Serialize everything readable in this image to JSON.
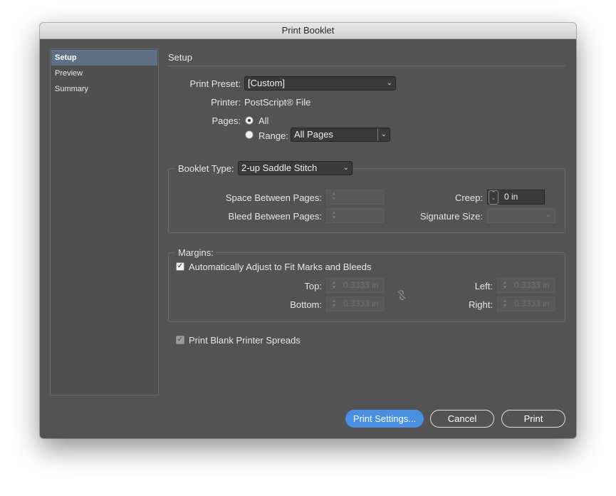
{
  "window": {
    "title": "Print Booklet"
  },
  "sidebar": {
    "items": [
      {
        "label": "Setup",
        "selected": true
      },
      {
        "label": "Preview",
        "selected": false
      },
      {
        "label": "Summary",
        "selected": false
      }
    ]
  },
  "setup": {
    "heading": "Setup",
    "preset_label": "Print Preset:",
    "preset_value": "[Custom]",
    "printer_label": "Printer:",
    "printer_value": "PostScript® File",
    "pages_label": "Pages:",
    "pages_all_label": "All",
    "pages_range_label": "Range:",
    "pages_range_value": "All Pages",
    "pages_selected": "All"
  },
  "booklet": {
    "type_label": "Booklet Type:",
    "type_value": "2-up Saddle Stitch",
    "space_label": "Space Between Pages:",
    "space_value": "",
    "bleed_label": "Bleed Between Pages:",
    "bleed_value": "",
    "creep_label": "Creep:",
    "creep_value": "0 in",
    "signature_label": "Signature Size:",
    "signature_value": ""
  },
  "margins": {
    "heading": "Margins:",
    "auto_adjust_label": "Automatically Adjust to Fit Marks and Bleeds",
    "auto_adjust_checked": true,
    "top_label": "Top:",
    "top_value": "0.3333 in",
    "bottom_label": "Bottom:",
    "bottom_value": "0.3333 in",
    "left_label": "Left:",
    "left_value": "0.3333 in",
    "right_label": "Right:",
    "right_value": "0.3333 in"
  },
  "blank_spreads": {
    "label": "Print Blank Printer Spreads",
    "checked": true
  },
  "buttons": {
    "print_settings": "Print Settings...",
    "cancel": "Cancel",
    "print": "Print"
  }
}
